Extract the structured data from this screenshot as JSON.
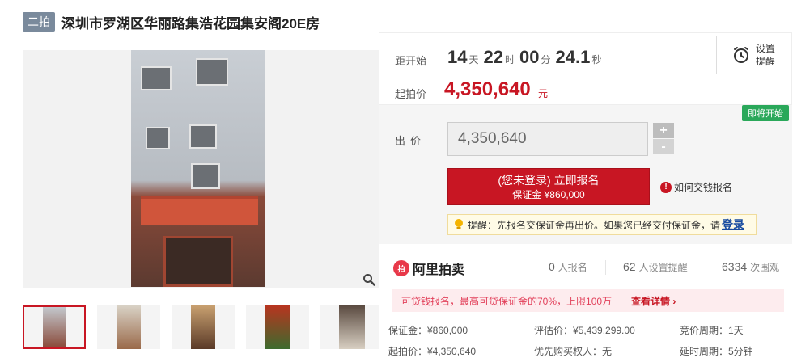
{
  "header": {
    "round_badge": "二拍",
    "title": "深圳市罗湖区华丽路集浩花园集安阁20E房"
  },
  "gallery": {
    "zoom_icon": "magnifier-icon",
    "thumbnail_count": 5
  },
  "countdown": {
    "label": "距开始",
    "days": "14",
    "days_unit": "天",
    "hours": "22",
    "hours_unit": "时",
    "minutes": "00",
    "minutes_unit": "分",
    "seconds": "24.1",
    "seconds_unit": "秒"
  },
  "reminder": {
    "icon": "alarm-clock-icon",
    "label": "设置提醒"
  },
  "start_price": {
    "label": "起拍价",
    "value": "4,350,640",
    "unit": "元"
  },
  "bid": {
    "badge": "即将开始",
    "label": "出价",
    "value": "4,350,640",
    "plus": "+",
    "minus": "-",
    "register_main": "(您未登录) 立即报名",
    "register_sub": "保证金 ¥860,000",
    "how_to_pay": "如何交钱报名",
    "tip": "提醒：先报名交保证金再出价。如果您已经交付保证金，请",
    "tip_login": "登录"
  },
  "stats": {
    "brand": "阿里拍卖",
    "registrants_count": "0",
    "registrants_label": "人报名",
    "reminders_count": "62",
    "reminders_label": "人设置提醒",
    "views_count": "6334",
    "views_label": "次围观"
  },
  "promo": {
    "text": "可贷钱报名，最高可贷保证金的70%，上限100万",
    "link": "查看详情"
  },
  "details": {
    "deposit": "保证金：¥860,000",
    "appraisal": "评估价：¥5,439,299.00",
    "cycle": "竞价周期：1天",
    "start_price": "起拍价：¥4,350,640",
    "priority": "优先购买权人：无",
    "delay": "延时周期：5分钟"
  },
  "colors": {
    "accent_red": "#c81623",
    "badge_green": "#2aa85a",
    "round_badge_gray": "#7a8a9c"
  }
}
